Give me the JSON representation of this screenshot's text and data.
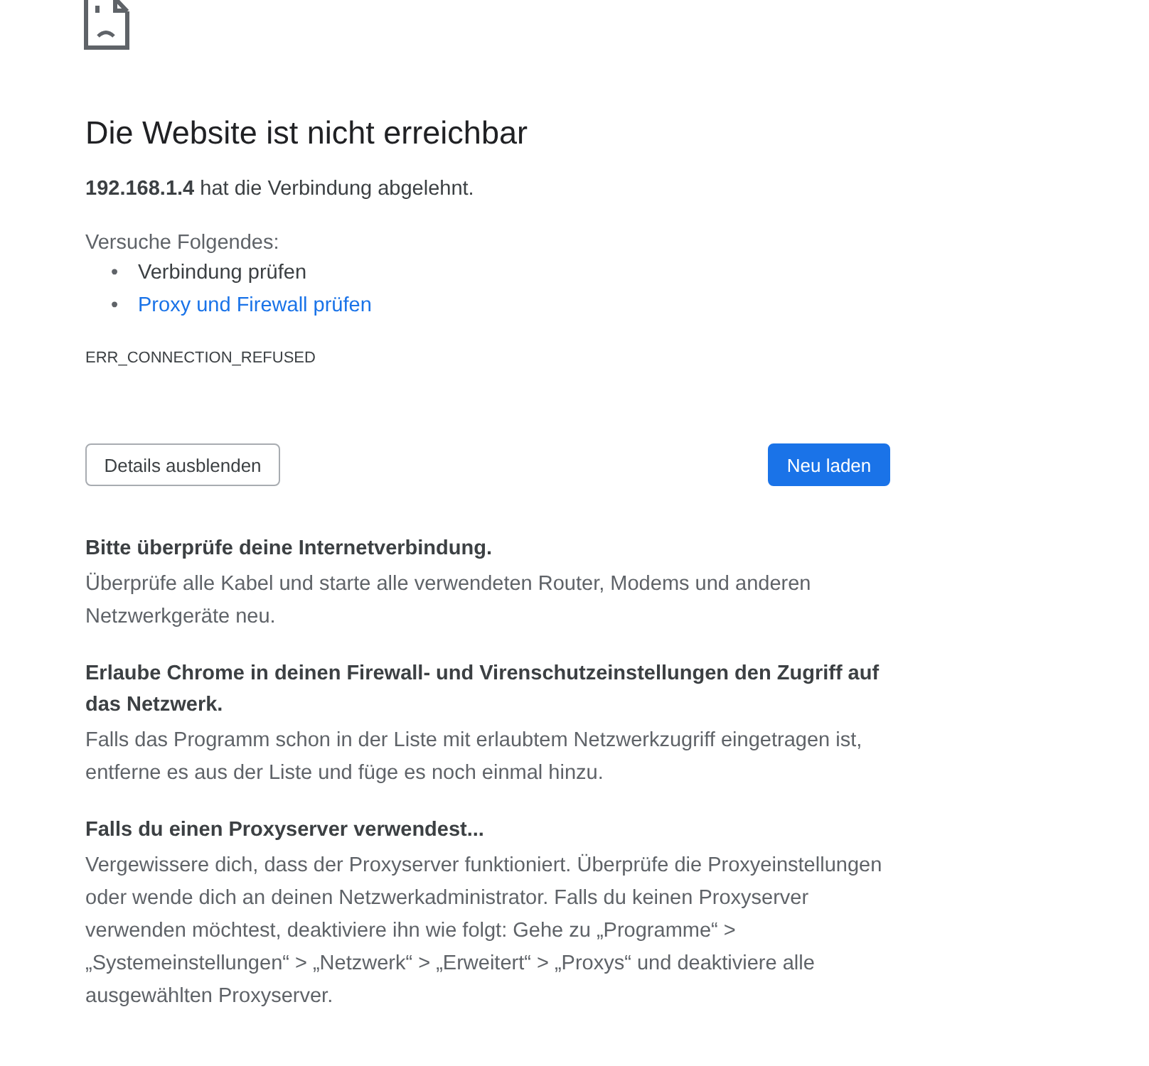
{
  "title": "Die Website ist nicht erreichbar",
  "message": "**192.168.1.4** hat die Verbindung abgelehnt.",
  "suggestions": {
    "heading": "Versuche Folgendes:",
    "items": [
      {
        "marker": "•",
        "text": "Verbindung prüfen",
        "kind": "text"
      },
      {
        "marker": "•",
        "text": "Proxy und Firewall prüfen",
        "kind": "link"
      }
    ]
  },
  "error_code": "ERR_CONNECTION_REFUSED",
  "buttons": [
    {
      "label": "Details ausblenden",
      "kind": "secondary"
    },
    {
      "label": "Neu laden",
      "kind": "primary"
    }
  ],
  "details": [
    {
      "heading": "Bitte überprüfe deine Internetverbindung.",
      "text": "Überprüfe alle Kabel und starte alle verwendeten Router, Modems und anderen Netzwerkgeräte neu."
    },
    {
      "heading": "Erlaube Chrome in deinen Firewall- und Virenschutzeinstellungen den Zugriff auf das Netzwerk.",
      "text": "Falls das Programm schon in der Liste mit erlaubtem Netzwerkzugriff eingetragen ist, entferne es aus der Liste und füge es noch einmal hinzu."
    },
    {
      "heading": "Falls du einen Proxyserver verwendest...",
      "text": "Vergewissere dich, dass der Proxyserver funktioniert. Überprüfe die Proxyeinstellungen oder wende dich an deinen Netzwerkadministrator. Falls du keinen Proxyserver verwenden möchtest, deaktiviere ihn wie folgt: Gehe zu „Programme“ > „Systemeinstellungen“ > „Netzwerk“ > „Erweitert“ > „Proxys“ und deaktiviere alle ausgewählten Proxyserver."
    }
  ]
}
